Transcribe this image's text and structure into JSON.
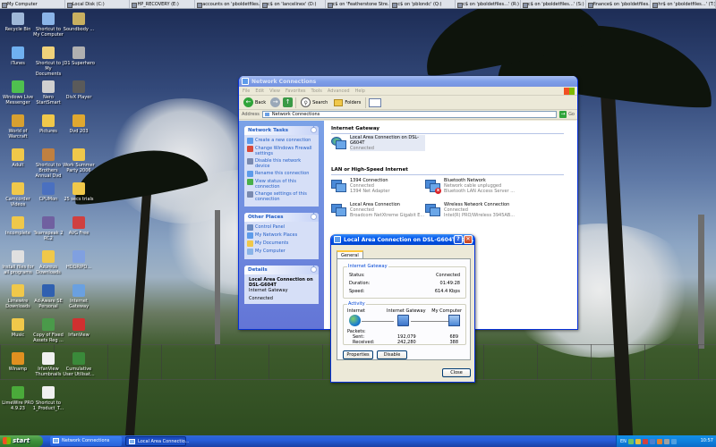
{
  "drive_bar": [
    "My Computer",
    "Local Disk (C:)",
    "HP_RECOVERY (E:)",
    "accounts on 'pboldetfiles…'",
    "c$ on 'lancelinex' (D:)",
    "c$ on 'Featherstone Stre…'",
    "c$ on 'pblondc' (Q:)",
    "c$ on 'pboldetfiles…' (R:)",
    "c$ on 'pboldetfiles…' (S:)",
    "finance$ on 'pboldetfiles…'",
    "hr$ on 'pboldetfiles…' (T:)"
  ],
  "desktop_icons": [
    {
      "label": "Recycle Bin",
      "color": "#9fb8d8"
    },
    {
      "label": "Shortcut to My Computer",
      "color": "#8ab4e8"
    },
    {
      "label": "Soundbody ...",
      "color": "#c9b060"
    },
    {
      "label": "iTunes",
      "color": "#6fb0f0"
    },
    {
      "label": "Shortcut to My Documents",
      "color": "#f0d27a"
    },
    {
      "label": "JD1 Superhero",
      "color": "#b0b0b0"
    },
    {
      "label": "Windows Live Messenger",
      "color": "#4fc04f"
    },
    {
      "label": "Nero StartSmart",
      "color": "#d0d0d0"
    },
    {
      "label": "DivX Player",
      "color": "#5a5a5a"
    },
    {
      "label": "World of Warcraft",
      "color": "#d8a030"
    },
    {
      "label": "Pictures",
      "color": "#f0c84a"
    },
    {
      "label": "Dvd 203",
      "color": "#e0a830"
    },
    {
      "label": "Adult",
      "color": "#f0c84a"
    },
    {
      "label": "Shortcut to Brothers Annual Dvd",
      "color": "#c08040"
    },
    {
      "label": "Work Summer Party 2006",
      "color": "#f0c84a"
    },
    {
      "label": "Camcorder Videos",
      "color": "#f0c84a"
    },
    {
      "label": "CPUMon",
      "color": "#4a70c0"
    },
    {
      "label": "25 secs trials",
      "color": "#f0c84a"
    },
    {
      "label": "Incomplete",
      "color": "#f0c84a"
    },
    {
      "label": "Teamspeak 2 RC2",
      "color": "#7060a0"
    },
    {
      "label": "AVG Free",
      "color": "#d04040"
    },
    {
      "label": "Install files for all programs",
      "color": "#e0e0e0"
    },
    {
      "label": "Azureus Downloads",
      "color": "#f0c84a"
    },
    {
      "label": "HDDRIPD...",
      "color": "#80a0e0"
    },
    {
      "label": "Limewire Downloads",
      "color": "#f0c84a"
    },
    {
      "label": "Ad-Aware SE Personal",
      "color": "#3060b0"
    },
    {
      "label": "Internet Gateway",
      "color": "#6aa0e0"
    },
    {
      "label": "Music",
      "color": "#f0c84a"
    },
    {
      "label": "Copy of Fixed Assets Reg ...",
      "color": "#4a9a4a"
    },
    {
      "label": "IrfanView",
      "color": "#d03030"
    },
    {
      "label": "Winamp",
      "color": "#e09020"
    },
    {
      "label": "IrfanView Thumbnails",
      "color": "#f0f0f0"
    },
    {
      "label": "Cumulative User Utilisat...",
      "color": "#3a8a3a"
    },
    {
      "label": "LimeWire PRO 4.9.23",
      "color": "#4aaa3a"
    },
    {
      "label": "Shortcut to 1_Product_T...",
      "color": "#f0f0f0"
    }
  ],
  "netwin": {
    "title": "Network Connections",
    "menu": [
      "File",
      "Edit",
      "View",
      "Favorites",
      "Tools",
      "Advanced",
      "Help"
    ],
    "toolbar": {
      "back": "Back",
      "search": "Search",
      "folders": "Folders"
    },
    "address_label": "Address",
    "address_value": "Network Connections",
    "go": "Go",
    "tasks": {
      "title": "Network Tasks",
      "items": [
        "Create a new connection",
        "Change Windows Firewall settings",
        "Disable this network device",
        "Rename this connection",
        "View status of this connection",
        "Change settings of this connection"
      ]
    },
    "other_places": {
      "title": "Other Places",
      "items": [
        "Control Panel",
        "My Network Places",
        "My Documents",
        "My Computer"
      ]
    },
    "details": {
      "title": "Details",
      "name": "Local Area Connection on DSL-G604T",
      "type": "Internet Gateway",
      "status": "Connected"
    },
    "group_internet_gateway": "Internet Gateway",
    "gateway_conn": {
      "name": "Local Area Connection on DSL-G604T",
      "status": "Connected"
    },
    "group_lan": "LAN or High-Speed Internet",
    "connections": [
      {
        "name": "1394 Connection",
        "status": "Connected",
        "device": "1394 Net Adapter"
      },
      {
        "name": "Bluetooth Network",
        "status": "Network cable unplugged",
        "device": "Bluetooth LAN Access Server ..."
      },
      {
        "name": "Local Area Connection",
        "status": "Connected",
        "device": "Broadcom NetXtreme Gigabit E..."
      },
      {
        "name": "Wireless Network Connection",
        "status": "Connected",
        "device": "Intel(R) PRO/Wireless 3945AB..."
      }
    ]
  },
  "status_dialog": {
    "title": "Local Area Connection on DSL-G604T Sta...",
    "tab": "General",
    "gateway_legend": "Internet Gateway",
    "status_label": "Status:",
    "status_value": "Connected",
    "duration_label": "Duration:",
    "duration_value": "01:49:28",
    "speed_label": "Speed:",
    "speed_value": "614.4 Kbps",
    "activity_legend": "Activity",
    "act_internet": "Internet",
    "act_gateway": "Internet Gateway",
    "act_computer": "My Computer",
    "packets_label": "Packets:",
    "sent_label": "Sent:",
    "sent_gw": "192,079",
    "sent_pc": "689",
    "received_label": "Received:",
    "received_gw": "242,280",
    "received_pc": "388",
    "properties": "Properties",
    "disable": "Disable",
    "close": "Close",
    "help": "?",
    "close_x": "✕"
  },
  "taskbar": {
    "start": "start",
    "tasks": [
      "Network Connections",
      "Local Area Connectio..."
    ],
    "lang": "EN",
    "clock": "10:57"
  }
}
